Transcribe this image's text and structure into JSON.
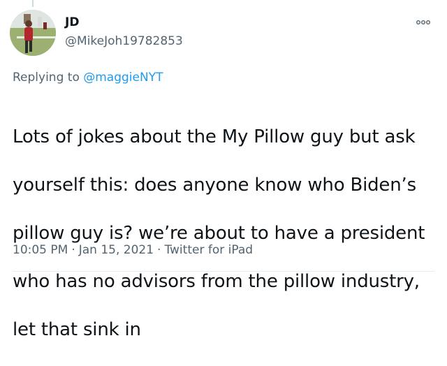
{
  "tweet": {
    "display_name": "JD",
    "handle": "@MikeJoh19782853",
    "reply_prefix": "Replying to",
    "reply_to": "@maggieNYT",
    "body_lines": [
      "Lots of jokes about the My Pillow guy but ask",
      "yourself this: does anyone know who Biden’s",
      "pillow guy is?  we’re about to have a president",
      "who has no advisors from the pillow industry,",
      "let that sink in"
    ],
    "time": "10:05 PM",
    "separator": "·",
    "date": "Jan 15, 2021",
    "source": "Twitter for iPad"
  },
  "icons": {
    "more": "more-horizontal-icon",
    "avatar": "user-avatar-photo"
  },
  "colors": {
    "text": "#0f1419",
    "secondary": "#536471",
    "link": "#1d9bf0",
    "divider": "#e6ecf0"
  }
}
